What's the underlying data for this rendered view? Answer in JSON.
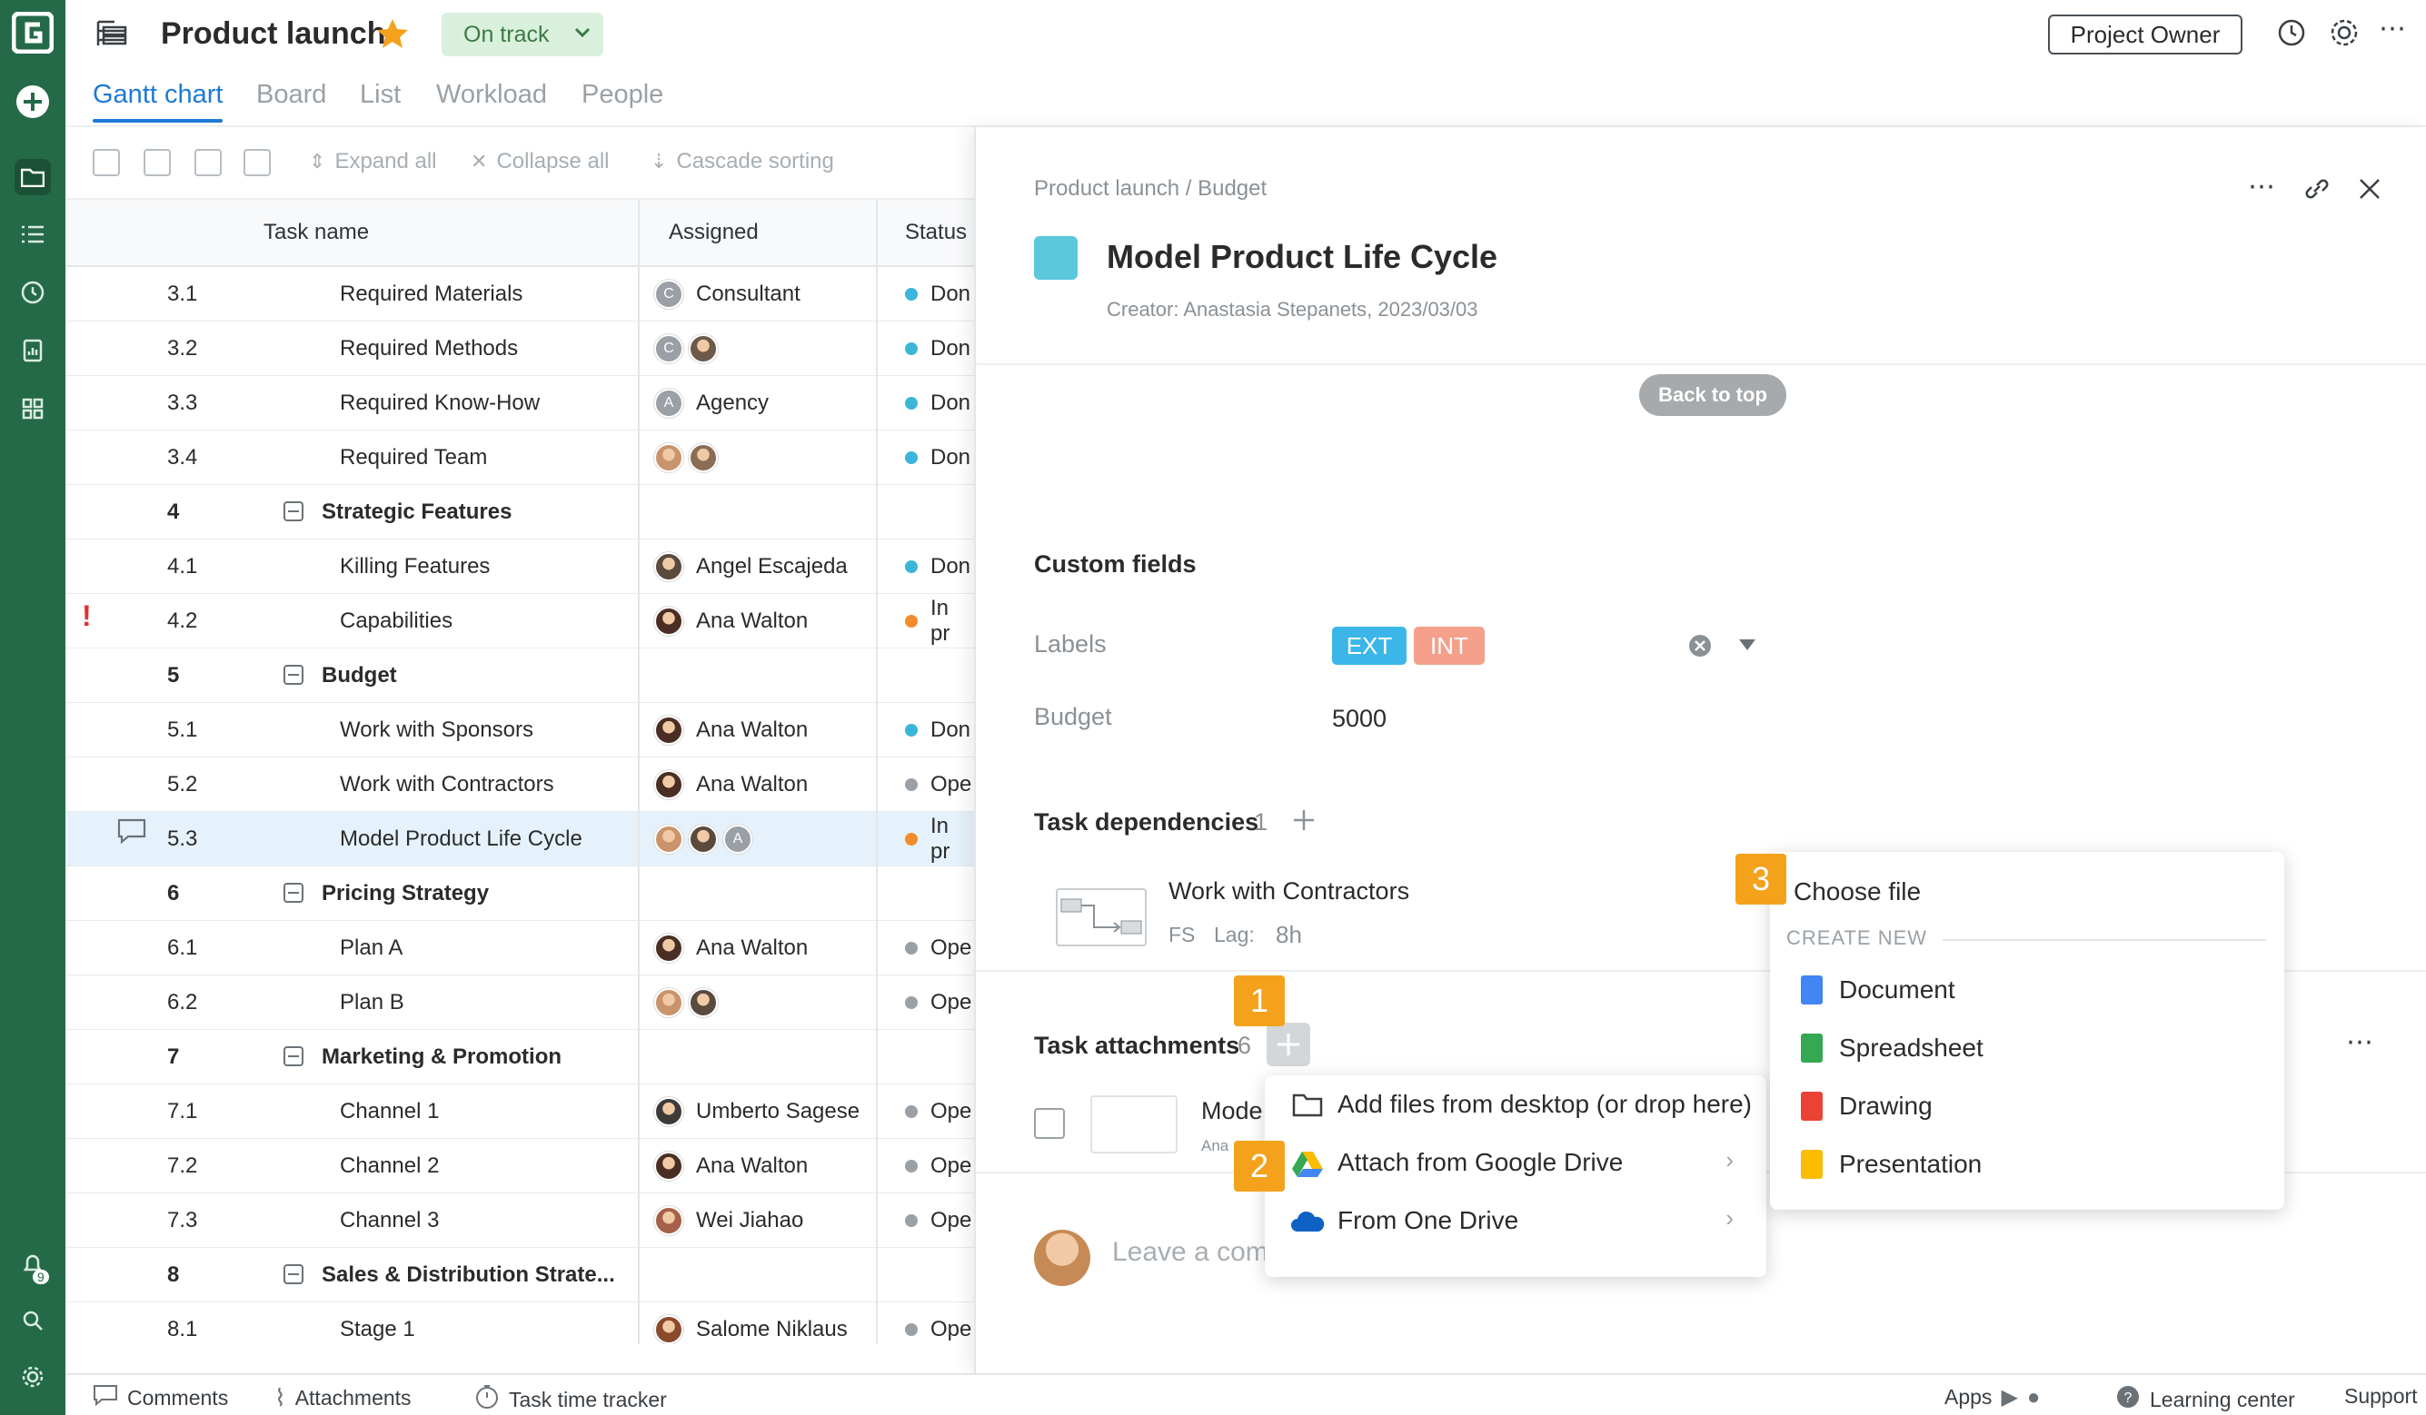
{
  "header": {
    "project_title": "Product launch",
    "status_label": "On track",
    "role_button": "Project Owner"
  },
  "tabs": [
    "Gantt chart",
    "Board",
    "List",
    "Workload",
    "People"
  ],
  "toolbar": {
    "expand_all": "Expand all",
    "collapse_all": "Collapse all",
    "cascade_sorting": "Cascade sorting"
  },
  "grid": {
    "columns": [
      "Task name",
      "Assigned",
      "Status"
    ],
    "rows": [
      {
        "num": "3.1",
        "name": "Required Materials",
        "assigned": "Consultant",
        "status": "Don",
        "status_color": "#3cb6d8",
        "group": false
      },
      {
        "num": "3.2",
        "name": "Required Methods",
        "assigned": "",
        "status": "Don",
        "status_color": "#3cb6d8",
        "group": false
      },
      {
        "num": "3.3",
        "name": "Required Know-How",
        "assigned": "Agency",
        "status": "Don",
        "status_color": "#3cb6d8",
        "group": false
      },
      {
        "num": "3.4",
        "name": "Required Team",
        "assigned": "",
        "status": "Don",
        "status_color": "#3cb6d8",
        "group": false
      },
      {
        "num": "4",
        "name": "Strategic Features",
        "assigned": "",
        "status": "",
        "status_color": "",
        "group": true
      },
      {
        "num": "4.1",
        "name": "Killing Features",
        "assigned": "Angel Escajeda",
        "status": "Don",
        "status_color": "#3cb6d8",
        "group": false
      },
      {
        "num": "4.2",
        "name": "Capabilities",
        "assigned": "Ana Walton",
        "status": "In pr",
        "status_color": "#f28c2a",
        "group": false
      },
      {
        "num": "5",
        "name": "Budget",
        "assigned": "",
        "status": "",
        "status_color": "",
        "group": true
      },
      {
        "num": "5.1",
        "name": "Work with Sponsors",
        "assigned": "Ana Walton",
        "status": "Don",
        "status_color": "#3cb6d8",
        "group": false
      },
      {
        "num": "5.2",
        "name": "Work with Contractors",
        "assigned": "Ana Walton",
        "status": "Ope",
        "status_color": "#9aa0a5",
        "group": false
      },
      {
        "num": "5.3",
        "name": "Model Product Life Cycle",
        "assigned": "",
        "status": "In pr",
        "status_color": "#f28c2a",
        "group": false
      },
      {
        "num": "6",
        "name": "Pricing Strategy",
        "assigned": "",
        "status": "",
        "status_color": "",
        "group": true
      },
      {
        "num": "6.1",
        "name": "Plan A",
        "assigned": "Ana Walton",
        "status": "Ope",
        "status_color": "#9aa0a5",
        "group": false
      },
      {
        "num": "6.2",
        "name": "Plan B",
        "assigned": "",
        "status": "Ope",
        "status_color": "#9aa0a5",
        "group": false
      },
      {
        "num": "7",
        "name": "Marketing & Promotion",
        "assigned": "",
        "status": "",
        "status_color": "",
        "group": true
      },
      {
        "num": "7.1",
        "name": "Channel 1",
        "assigned": "Umberto Sagese",
        "status": "Ope",
        "status_color": "#9aa0a5",
        "group": false
      },
      {
        "num": "7.2",
        "name": "Channel 2",
        "assigned": "Ana Walton",
        "status": "Ope",
        "status_color": "#9aa0a5",
        "group": false
      },
      {
        "num": "7.3",
        "name": "Channel 3",
        "assigned": "Wei Jiahao",
        "status": "Ope",
        "status_color": "#9aa0a5",
        "group": false
      },
      {
        "num": "8",
        "name": "Sales & Distribution Strate...",
        "assigned": "",
        "status": "",
        "status_color": "",
        "group": true
      },
      {
        "num": "8.1",
        "name": "Stage 1",
        "assigned": "Salome Niklaus",
        "status": "Ope",
        "status_color": "#9aa0a5",
        "group": false
      }
    ]
  },
  "panel": {
    "breadcrumb": "Product launch / Budget",
    "title": "Model Product Life Cycle",
    "creator": "Creator: Anastasia Stepanets, 2023/03/03",
    "back_to_top": "Back to top",
    "custom_fields_heading": "Custom fields",
    "labels_label": "Labels",
    "label_ext": "EXT",
    "label_int": "INT",
    "budget_label": "Budget",
    "budget_value": "5000",
    "dependencies_heading": "Task dependencies",
    "dependencies_count": "1",
    "dependency_name": "Work with Contractors",
    "dependency_type": "FS",
    "dependency_lag_label": "Lag:",
    "dependency_lag": "8h",
    "attachments_heading": "Task attachments",
    "attachments_count": "6",
    "attachment_name": "Mode",
    "attachment_sub": "Ana",
    "comment_placeholder": "Leave a com"
  },
  "attach_menu": {
    "items": [
      "Add files from desktop (or drop here)",
      "Attach from Google Drive",
      "From One Drive"
    ]
  },
  "create_menu": {
    "choose_file": "Choose file",
    "create_new": "CREATE NEW",
    "items": [
      "Document",
      "Spreadsheet",
      "Drawing",
      "Presentation"
    ],
    "colors": [
      "#4285f4",
      "#34a853",
      "#ea4335",
      "#fbbc04"
    ]
  },
  "badges": [
    "1",
    "2",
    "3"
  ],
  "footer": {
    "comments": "Comments",
    "attachments": "Attachments",
    "time_tracker": "Task time tracker",
    "apps": "Apps",
    "learning_center": "Learning center",
    "support": "Support"
  },
  "rail": {
    "notification_count": "9"
  },
  "colors": {
    "brand_green": "#256a48",
    "accent_blue": "#1e7ad6",
    "task_color": "#5bc8dc",
    "badge_orange": "#f4a21b"
  }
}
